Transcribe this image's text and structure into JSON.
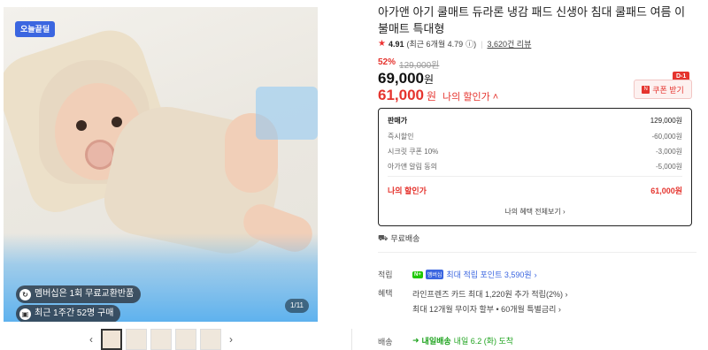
{
  "gallery": {
    "badge": "오늘끝딜",
    "promo1": "멤버십은 1회 무료교환반품",
    "promo2": "최근 1주간 52명 구매",
    "counter": "1/11"
  },
  "product": {
    "title": "아가앤 아기 쿨매트 듀라론 냉감 패드 신생아 침대 쿨패드 여름 이불매트 특대형",
    "rating": "4.91",
    "rating_detail": "(최근 6개월 4.79",
    "review_count": "3,620건 리뷰",
    "discount_pct": "52%",
    "original_price": "129,000원",
    "price": "69,000",
    "my_price": "61,000",
    "won": "원",
    "my_price_label": "나의 할인가",
    "coupon_dday": "D-1",
    "coupon_label": "쿠폰 받기"
  },
  "breakdown": {
    "header_label": "판매가",
    "header_value": "129,000원",
    "rows": [
      {
        "label": "즉시할인",
        "value": "-60,000원"
      },
      {
        "label": "시크릿 쿠폰 10%",
        "value": "-3,000원"
      },
      {
        "label": "아가앤 알림 동의",
        "value": "-5,000원"
      }
    ],
    "mine_label": "나의 할인가",
    "mine_value": "61,000원",
    "all_benefits": "나의 혜택 전체보기"
  },
  "shipping": {
    "free": "무료배송",
    "points_label": "적립",
    "points_value": "최대 적립 포인트 3,590원",
    "benefit_label": "혜택",
    "benefit_1": "라인프렌즈 카드 최대 1,220원 추가 적립(2%)",
    "benefit_2": "최대 12개월 무이자 할부 • 60개월 특별금리",
    "delivery_label": "배송",
    "delivery_badge": "내일배송",
    "delivery_value": "내일 6.2 (화) 도착"
  }
}
